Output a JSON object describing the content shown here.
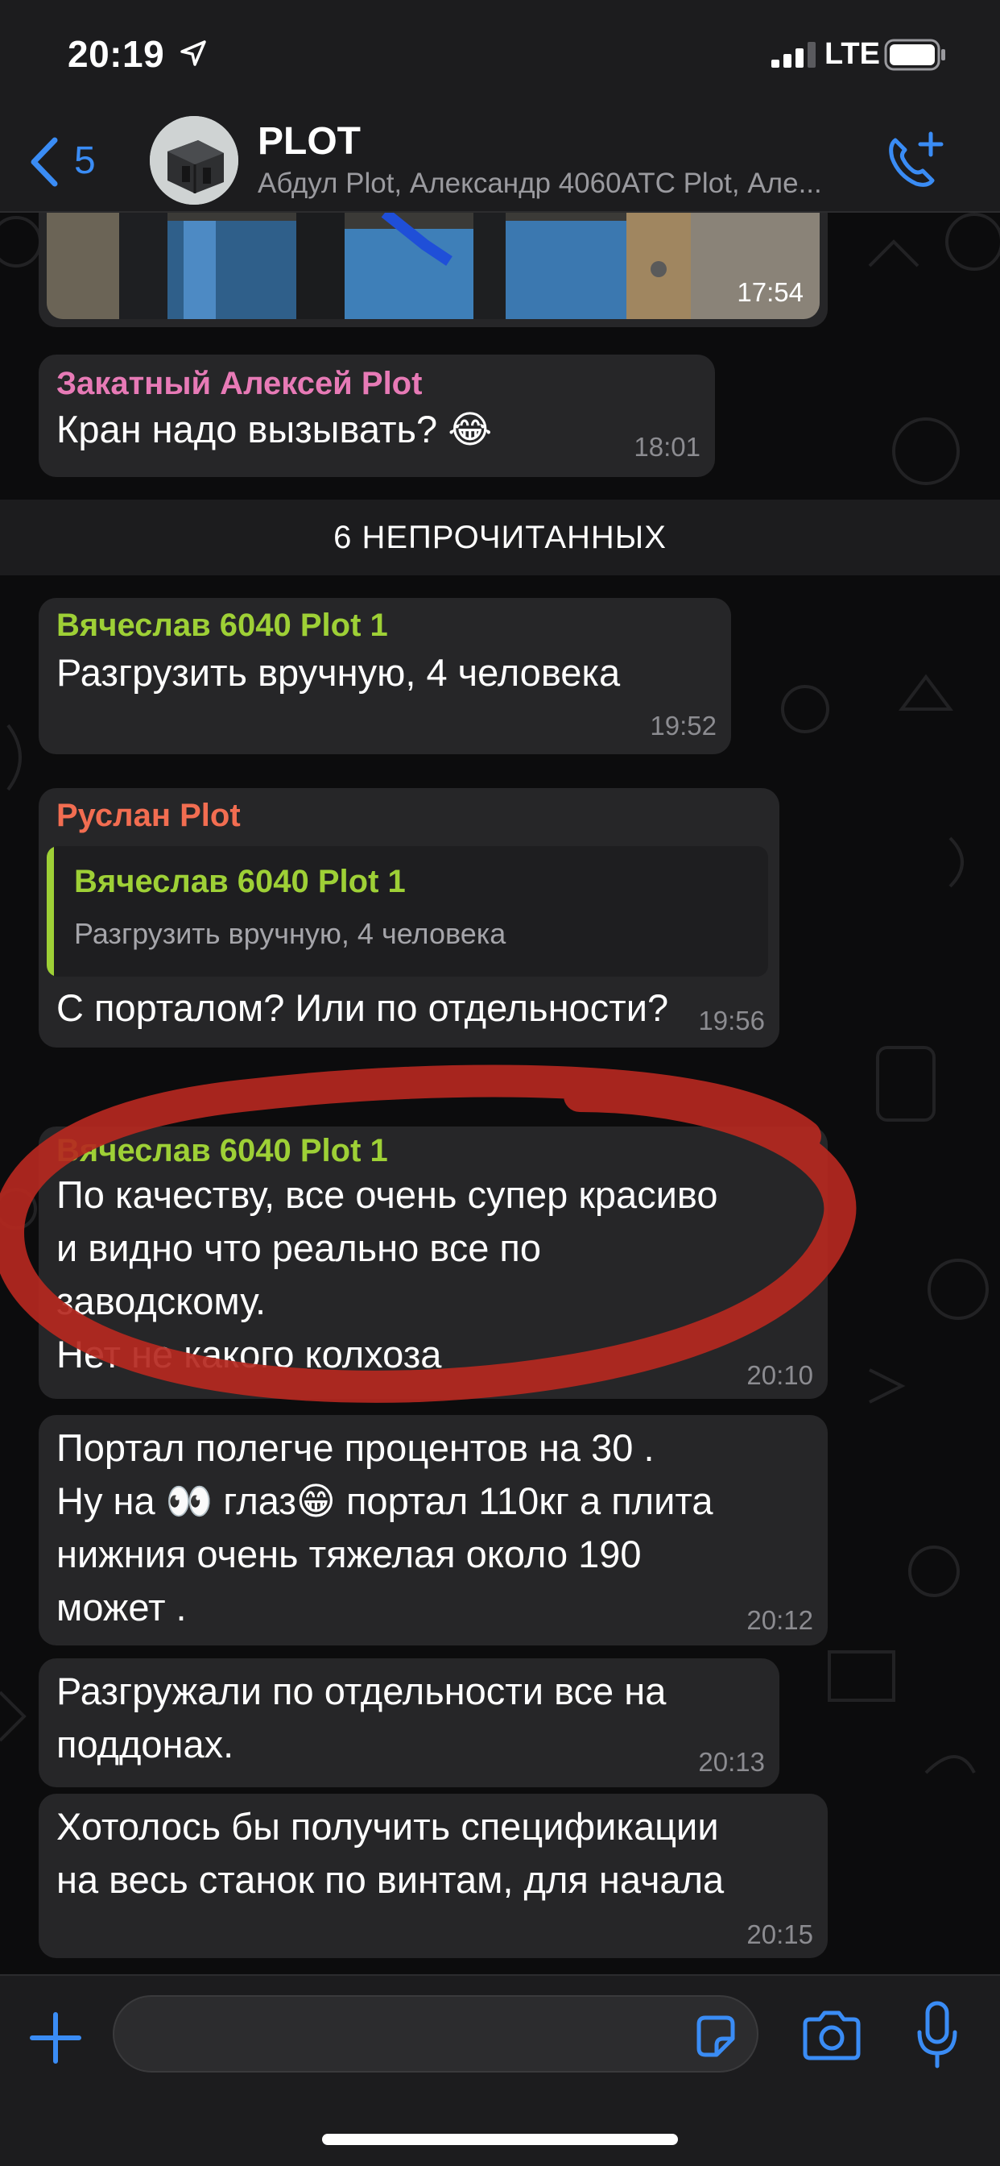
{
  "status": {
    "time": "20:19",
    "network": "LTE"
  },
  "header": {
    "back_count": "5",
    "title": "PLOT",
    "subtitle": "Абдул Plot, Александр 4060АТС Plot, Але..."
  },
  "colors": {
    "accent": "#3a8cf5",
    "bubble": "#262628",
    "sender_pink": "#e77ab6",
    "sender_green": "#9ed036",
    "sender_red": "#f26d51",
    "annotation_red": "#b5281f"
  },
  "photo_message": {
    "time": "17:54"
  },
  "messages": [
    {
      "sender": "Закатный Алексей Plot",
      "text": "Кран надо вызывать? 😂",
      "time": "18:01"
    }
  ],
  "unread_label": "6 НЕПРОЧИТАННЫХ",
  "unread_messages": [
    {
      "sender": "Вячеслав 6040 Plot 1",
      "text": "Разгрузить вручную, 4 человека",
      "time": "19:52"
    },
    {
      "sender": "Руслан Plot",
      "reply_to": {
        "sender": "Вячеслав 6040 Plot 1",
        "text": "Разгрузить вручную, 4 человека"
      },
      "text": "С порталом? Или по отдельности?",
      "time": "19:56"
    },
    {
      "sender": "Вячеслав 6040 Plot 1",
      "text": "По качеству, все очень супер красиво\nи видно что реально все по\nзаводскому.\nНет не какого колхоза",
      "time": "20:10"
    },
    {
      "text": "Портал полегче процентов на 30 .\nНу на 👀 глаз😁 портал 110кг а плита\nнижния очень тяжелая около 190\nможет .",
      "time": "20:12"
    },
    {
      "text": "Разгружали по отдельности все на\nподдонах.",
      "time": "20:13"
    },
    {
      "text": "Хотолось бы получить спецификации\nна весь станок по винтам, для начала",
      "time": "20:15"
    }
  ],
  "input": {
    "placeholder": ""
  },
  "icons": {
    "back": "chevron-left-icon",
    "call": "phone-plus-icon",
    "attach": "plus-icon",
    "sticker": "sticker-icon",
    "camera": "camera-icon",
    "mic": "microphone-icon"
  }
}
